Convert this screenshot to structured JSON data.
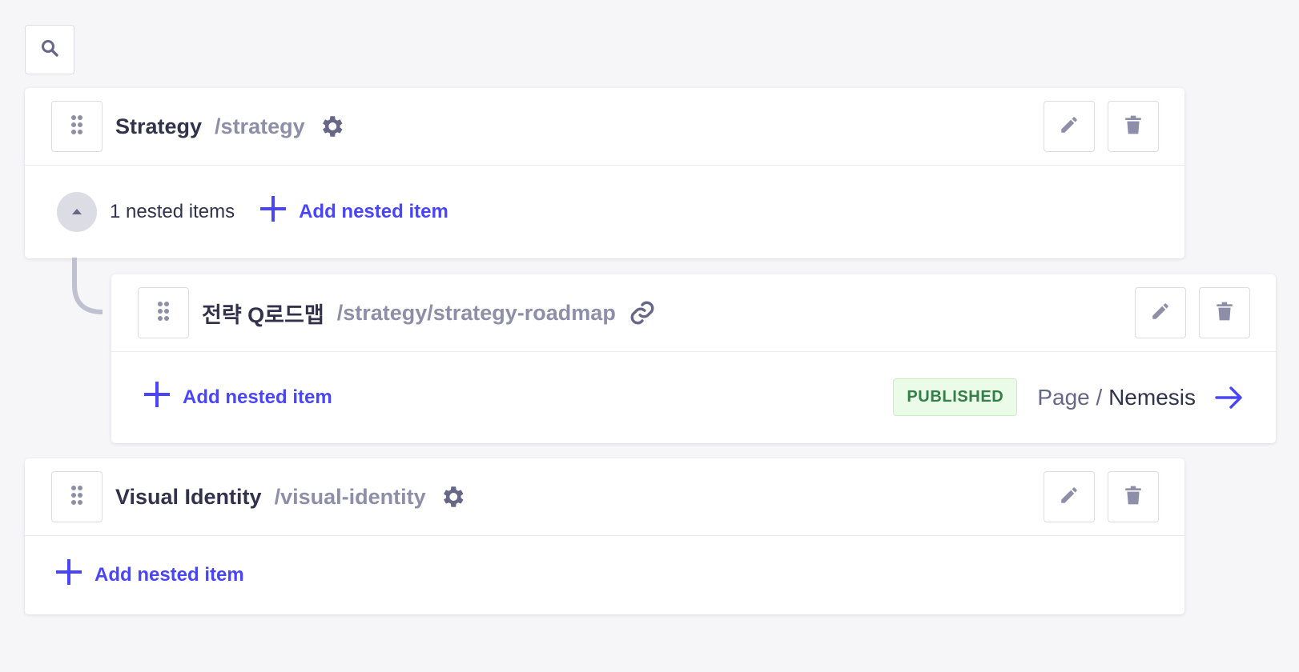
{
  "search": {
    "icon": "search-icon"
  },
  "items": [
    {
      "title": "Strategy",
      "path": "/strategy",
      "type_icon": "gear-icon",
      "nested_count_label": "1 nested items",
      "add_nested_label": "Add nested item"
    },
    {
      "title": "전략 Q로드맵",
      "path": "/strategy/strategy-roadmap",
      "type_icon": "link-icon",
      "add_nested_label": "Add nested item",
      "status_badge": "PUBLISHED",
      "related_type": "Page",
      "related_separator": "/",
      "related_name": "Nemesis"
    },
    {
      "title": "Visual Identity",
      "path": "/visual-identity",
      "type_icon": "gear-icon",
      "add_nested_label": "Add nested item"
    }
  ],
  "colors": {
    "accent": "#4945ff",
    "text_primary": "#32324d",
    "text_muted": "#8e8ea9",
    "badge_bg": "#eafbe7",
    "badge_text": "#328048",
    "background": "#f6f6f9"
  }
}
